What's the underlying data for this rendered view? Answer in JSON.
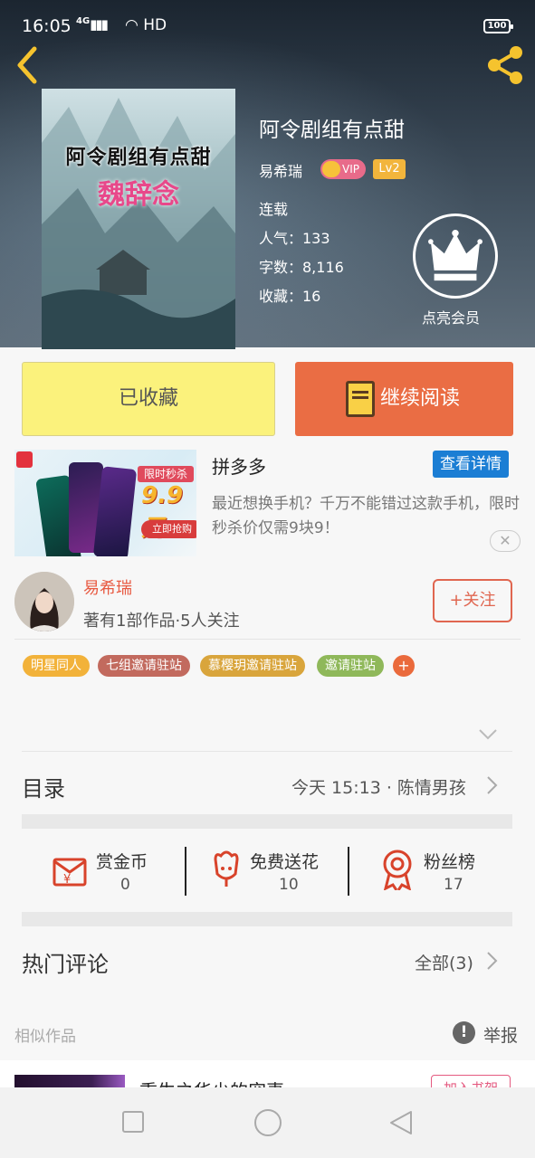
{
  "status_bar": {
    "time": "16:05",
    "network": "4G",
    "hd": "HD",
    "battery": "100"
  },
  "book": {
    "title": "阿令剧组有点甜",
    "cover_title": "阿令剧组有点甜",
    "cover_author": "魏辞念",
    "author": "易希瑞",
    "vip": "VIP",
    "level": "Lv2",
    "status": "连载",
    "popularity": "人气：133",
    "word_count": "字数：8,116",
    "favorites": "收藏：16",
    "member_label": "点亮会员"
  },
  "actions": {
    "favorited": "已收藏",
    "continue_reading": "继续阅读"
  },
  "ad": {
    "brand": "拼多多",
    "detail_button": "查看详情",
    "description": "最近想换手机？千万不能错过这款手机，限时秒杀价仅需9块9！",
    "sale_label": "限时秒杀",
    "price": "9.9元",
    "buy_label": "立即抢购",
    "close": "✕"
  },
  "author_card": {
    "name": "易希瑞",
    "stats": "著有1部作品·5人关注",
    "follow": "+关注"
  },
  "tags": [
    {
      "label": "明星同人",
      "color": "#f2b23a"
    },
    {
      "label": "七组邀请驻站",
      "color": "#c26a5e"
    },
    {
      "label": "慕樱玥邀请驻站",
      "color": "#d9a53c"
    },
    {
      "label": "邀请驻站",
      "color": "#8fb85a"
    }
  ],
  "tag_plus": "+",
  "catalog": {
    "title": "目录",
    "latest": "今天 15:13 · 陈情男孩"
  },
  "stats": [
    {
      "label": "赏金币",
      "value": "0",
      "icon": "red-envelope-icon"
    },
    {
      "label": "免费送花",
      "value": "10",
      "icon": "flower-icon"
    },
    {
      "label": "粉丝榜",
      "value": "17",
      "icon": "medal-icon"
    }
  ],
  "comments": {
    "title": "热门评论",
    "all": "全部(3)"
  },
  "similar": {
    "title": "相似作品",
    "report": "举报",
    "report_icon": "!"
  },
  "similar_item": {
    "title": "重生之华少的宠妻",
    "add_shelf": "加入书架"
  },
  "colors": {
    "accent": "#ea6d44",
    "favorite_bg": "#fbf27c",
    "icon_red": "#d8432b"
  }
}
